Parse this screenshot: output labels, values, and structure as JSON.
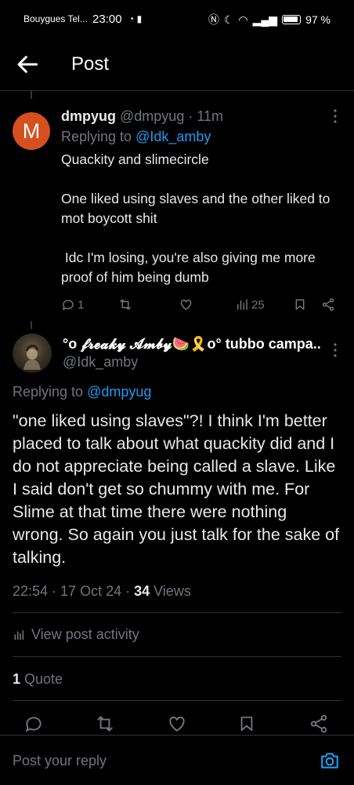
{
  "status_bar": {
    "carrier": "Bouygues Tel...",
    "time": "23:00",
    "battery": "97 %"
  },
  "header": {
    "title": "Post"
  },
  "reply_post": {
    "avatar_letter": "M",
    "display_name": "dmpyug",
    "handle": "@dmpyug",
    "separator": "·",
    "time_ago": "11m",
    "replying_label": "Replying to",
    "replying_handle": "@Idk_amby",
    "paragraphs": [
      "Quackity and slimecircle",
      "One  liked using  slaves and the other liked to mot boycott shit",
      " Idc I'm losing, you're also giving me more proof of him being dumb"
    ],
    "actions": {
      "reply_count": "1",
      "repost_count": "",
      "like_count": "",
      "views_count": "25"
    }
  },
  "main_post": {
    "display_name": "°o 𝓯𝓻𝓮𝓪𝓴𝔂 𝓐𝓶𝓫𝔂🍉🎗️o° tubbo campa...",
    "handle": "@Idk_amby",
    "replying_label": "Replying to",
    "replying_handle": "@dmpyug",
    "body": "\"one liked using slaves\"?! I think I'm better placed to talk about what quackity did and I do not appreciate being called a slave. Like I said don't get so chummy with me. For Slime at that time there were nothing wrong. So again you just talk for the sake of talking.",
    "timestamp": "22:54 · 17 Oct 24 · ",
    "views_count": "34",
    "views_label": " Views",
    "activity_label": "View post activity",
    "quote_count": "1",
    "quote_label": " Quote"
  },
  "reply_bar": {
    "placeholder": "Post your reply"
  },
  "colors": {
    "background": "#000000",
    "accent": "#1d9bf0",
    "muted_text": "#71767b",
    "avatar_m": "#d64f1f"
  },
  "icons": [
    "back-arrow-icon",
    "more-icon",
    "reply-icon",
    "repost-icon",
    "like-icon",
    "views-icon",
    "bookmark-icon",
    "share-icon",
    "activity-icon",
    "camera-icon"
  ]
}
